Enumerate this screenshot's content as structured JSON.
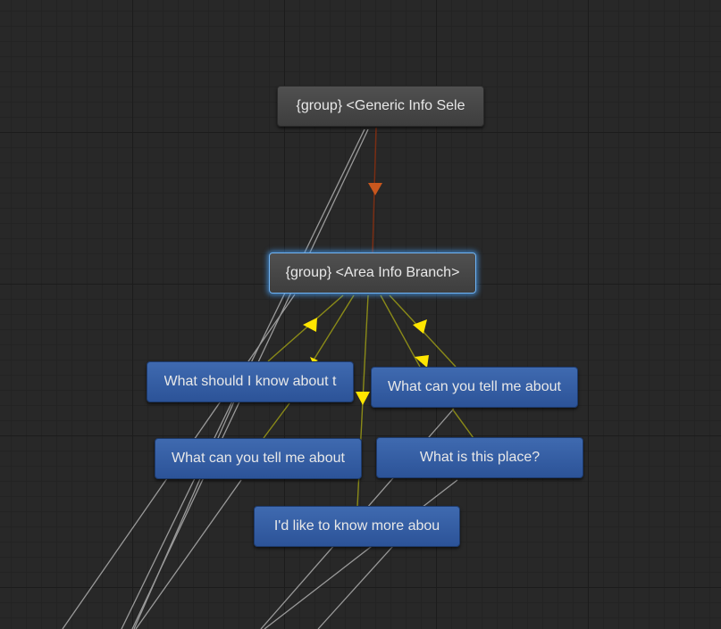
{
  "graph": {
    "nodes": {
      "generic_info": "{group} <Generic Info Sele",
      "area_info_branch": "{group} <Area Info Branch>",
      "what_should_i_know": "What should I know about t",
      "what_can_you_tell_1": "What can you tell me about",
      "what_can_you_tell_2": "What can you tell me about",
      "what_is_this_place": "What is this place?",
      "id_like_to_know": "I'd like to know more abou"
    },
    "colors": {
      "grid_background": "#282828",
      "group_node": "#464646",
      "entry_node": "#3560a6",
      "selection_glow": "#4a9be8",
      "link_primary": "#7a2e14",
      "link_arrow_primary": "#c8571e",
      "link_child": "#8a8a18",
      "link_arrow_child": "#ffe600",
      "link_external": "#9a9a9a"
    }
  }
}
